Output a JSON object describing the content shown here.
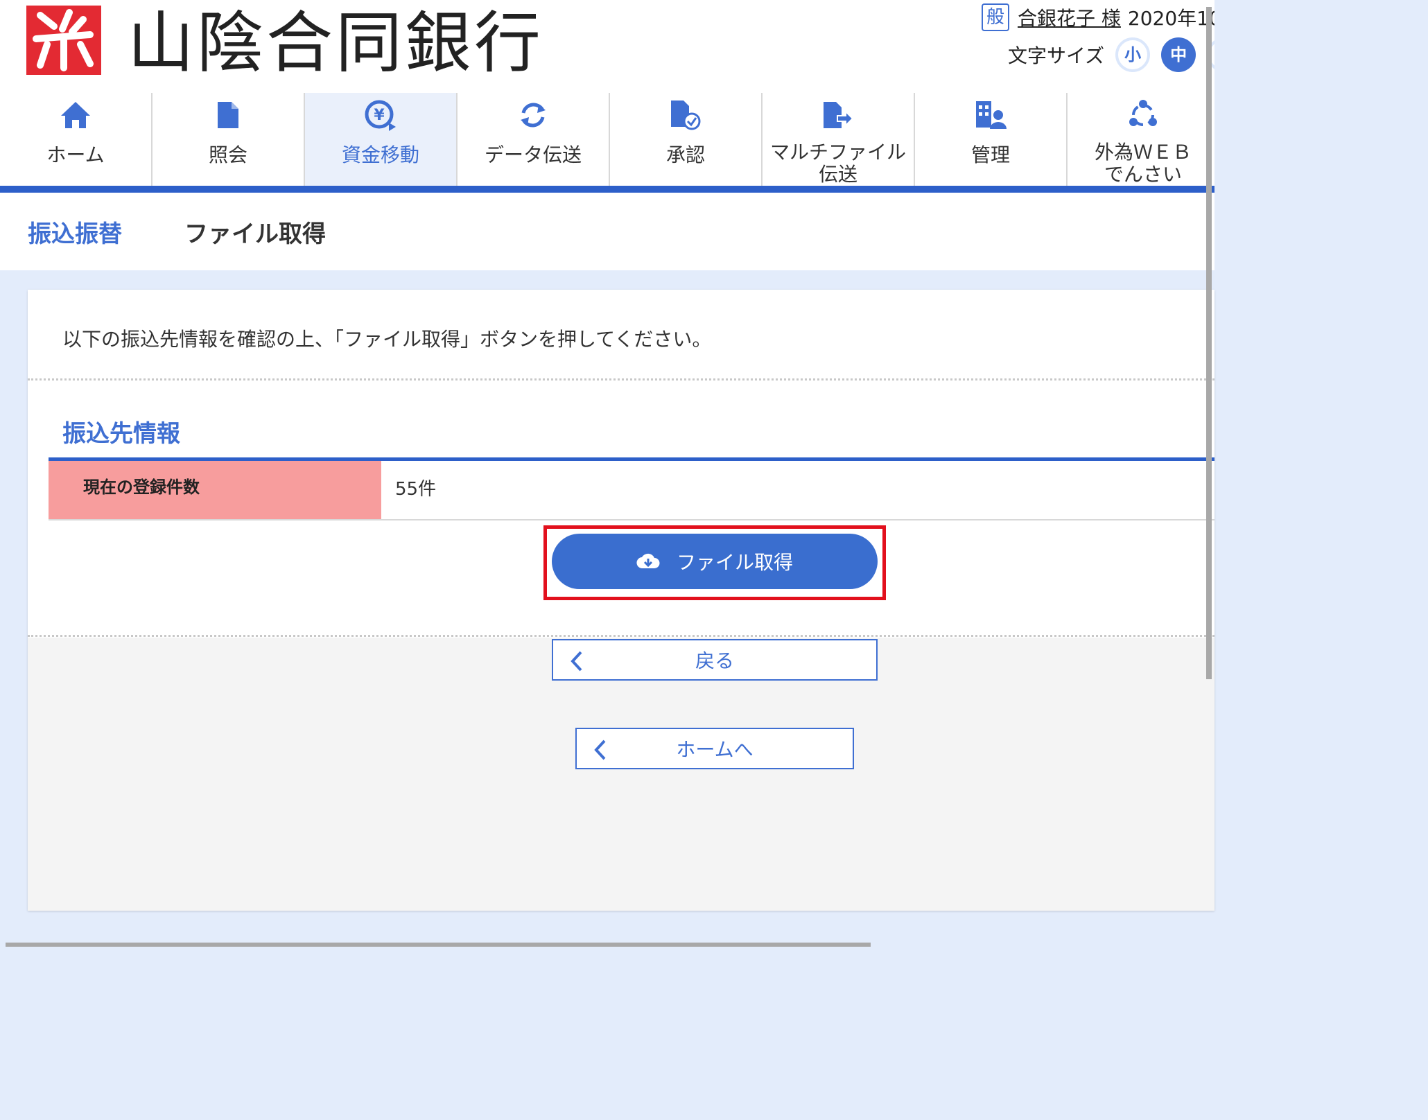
{
  "header": {
    "logo_text": "山陰合同銀行",
    "user": {
      "role_badge": "般",
      "name": "合銀花子 様",
      "date": "2020年10"
    },
    "font_size": {
      "label": "文字サイズ",
      "small": "小",
      "medium": "中",
      "selected": "中"
    }
  },
  "nav": {
    "items": [
      {
        "label": "ホーム",
        "icon": "home-icon"
      },
      {
        "label": "照会",
        "icon": "document-icon"
      },
      {
        "label": "資金移動",
        "icon": "yen-transfer-icon",
        "active": true
      },
      {
        "label": "データ伝送",
        "icon": "refresh-icon"
      },
      {
        "label": "承認",
        "icon": "document-check-icon"
      },
      {
        "label_line1": "マルチファイル",
        "label_line2": "伝送",
        "icon": "file-transfer-icon"
      },
      {
        "label": "管理",
        "icon": "building-user-icon"
      },
      {
        "label_line1": "外為ＷＥＢ",
        "label_line2": "でんさい",
        "icon": "network-icon"
      }
    ]
  },
  "title_bar": {
    "breadcrumb": "振込振替",
    "page_title": "ファイル取得"
  },
  "main": {
    "instruction": "以下の振込先情報を確認の上、「ファイル取得」ボタンを押してください。",
    "section_title": "振込先情報",
    "table": {
      "label": "現在の登録件数",
      "value": "55件"
    },
    "download_button": "ファイル取得",
    "back_button": "戻る",
    "home_button": "ホームへ"
  },
  "colors": {
    "accent": "#3f6fd2",
    "nav_bar": "#2d5fc9",
    "highlight": "#e2101d",
    "table_label_bg": "#f79d9d",
    "page_bg": "#e3ecfb"
  }
}
